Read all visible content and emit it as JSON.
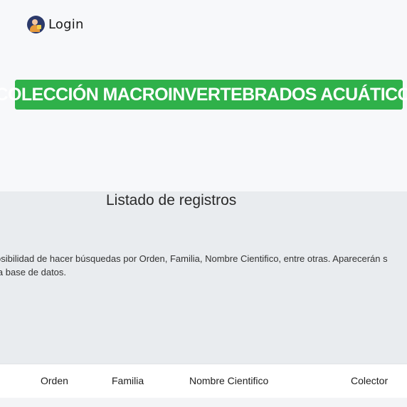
{
  "header": {
    "login_label": "Login",
    "login_icon": "user-lock-icon"
  },
  "banner": {
    "title": "COLECCIÓN MACROINVERTEBRADOS ACUÁTICOS",
    "color": "#2fb14a"
  },
  "listing": {
    "title": "Listado de registros",
    "description_line1": "osibilidad de hacer búsquedas por Orden, Familia, Nombre Cientifico, entre otras. Aparecerán s",
    "description_line2": " la base de datos."
  },
  "table": {
    "columns": [
      "Orden",
      "Familia",
      "Nombre Cientifico",
      "Colector"
    ]
  }
}
